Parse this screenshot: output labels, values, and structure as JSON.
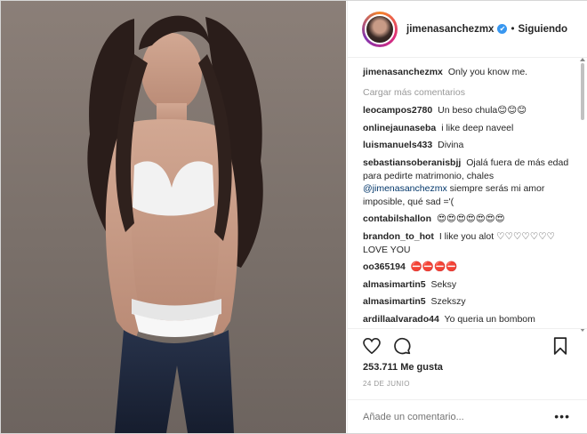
{
  "post": {
    "username": "jimenasanchezmx",
    "verified_badge": "✔",
    "separator": "•",
    "follow_status": "Siguiendo"
  },
  "caption": {
    "username": "jimenasanchezmx",
    "text": "Only you know me."
  },
  "load_more_label": "Cargar más comentarios",
  "comments": [
    {
      "user": "leocampos2780",
      "text": "Un beso chula😊😊😊"
    },
    {
      "user": "onlinejaunaseba",
      "text": "i like deep naveel"
    },
    {
      "user": "luismanuels433",
      "text": "Divina"
    },
    {
      "user": "sebastiansoberanisbjj",
      "text": "Ojalá fuera de más edad para pedirte matrimonio, chales",
      "mention": "@jimenasanchezmx",
      "text_after": " siempre serás mi amor imposible, qué sad ='("
    },
    {
      "user": "contabilshallon",
      "text": "😍😍😍😍😍😍😍"
    },
    {
      "user": "brandon_to_hot",
      "text": "I like you alot ♡♡♡♡♡♡♡ LOVE YOU"
    },
    {
      "user": "oo365194",
      "text": "⛔⛔⛔⛔"
    },
    {
      "user": "almasimartin5",
      "text": "Seksy"
    },
    {
      "user": "almasimartin5",
      "text": "Szekszy"
    },
    {
      "user": "ardillaalvarado44",
      "text": "Yo queria un bombom"
    }
  ],
  "likes": "253.711 Me gusta",
  "date": "24 DE JUNIO",
  "add_comment_placeholder": "Añade un comentario...",
  "more_options": "•••",
  "icons": {
    "like": "heart-icon",
    "comment": "comment-icon",
    "save": "bookmark-icon"
  },
  "colors": {
    "link": "#003569",
    "muted": "#999999",
    "verified": "#3897f0",
    "text": "#262626"
  }
}
